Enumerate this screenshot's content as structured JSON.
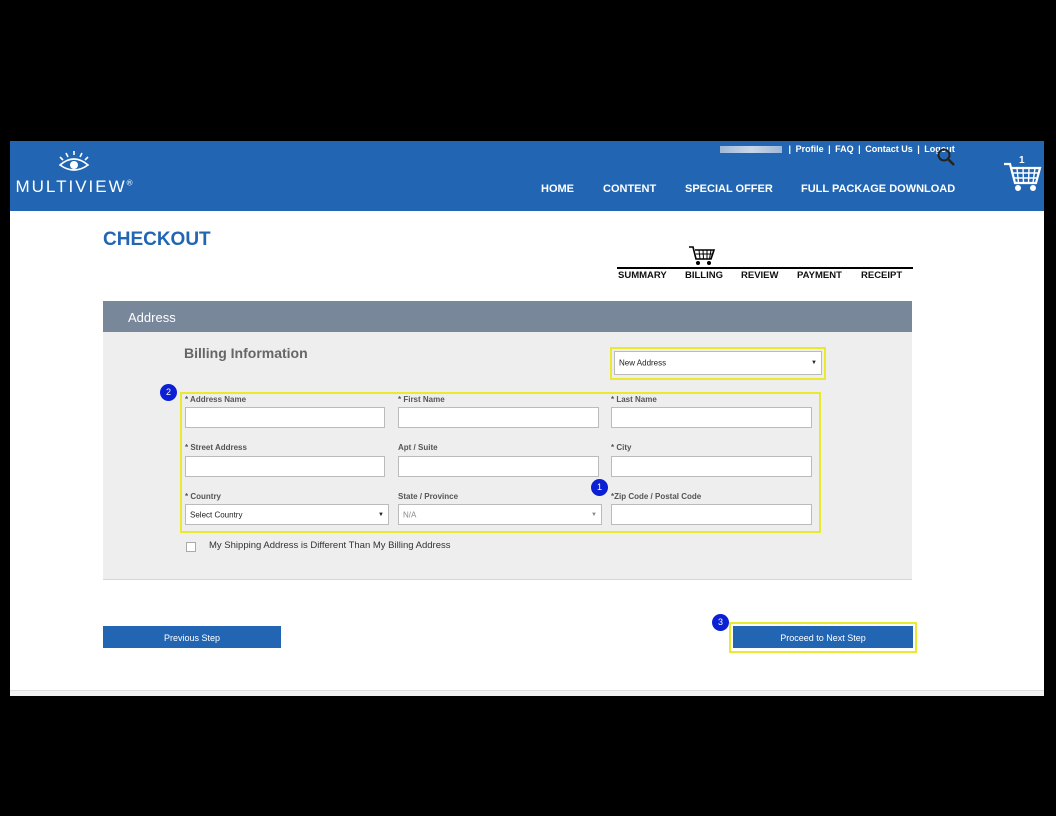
{
  "header": {
    "logo": {
      "text": "MULTIVIEW",
      "mark": "®"
    },
    "util_links": [
      "Profile",
      "FAQ",
      "Contact Us",
      "Logout"
    ],
    "util_sep": "|",
    "nav": [
      "HOME",
      "CONTENT",
      "SPECIAL OFFER",
      "FULL PACKAGE DOWNLOAD"
    ],
    "cart_count": "1",
    "icons": {
      "search": "search-icon",
      "cart": "shopping-cart-icon",
      "logo": "eye-logo-icon"
    }
  },
  "page": {
    "title": "CHECKOUT",
    "steps": [
      "SUMMARY",
      "BILLING",
      "REVIEW",
      "PAYMENT",
      "RECEIPT"
    ],
    "active_step": "BILLING"
  },
  "panel": {
    "header": "Address",
    "billing_title": "Billing Information",
    "address_select": "New Address",
    "fields": {
      "address_name": "* Address Name",
      "first_name": "* First Name",
      "last_name": "* Last Name",
      "street": "* Street Address",
      "apt": "Apt / Suite",
      "city": "* City",
      "country": "* Country",
      "state": "State / Province",
      "zip": "*Zip Code / Postal Code"
    },
    "country_value": "Select Country",
    "state_value": "N/A",
    "checkbox_label": "My Shipping Address is Different Than My Billing Address"
  },
  "buttons": {
    "previous": "Previous Step",
    "next": "Proceed to Next Step"
  },
  "badges": [
    "1",
    "2",
    "3"
  ],
  "colors": {
    "brand_blue": "#2266b3",
    "panel_header": "#78879a",
    "highlight": "#e9e930",
    "badge": "#0a1fd6"
  }
}
